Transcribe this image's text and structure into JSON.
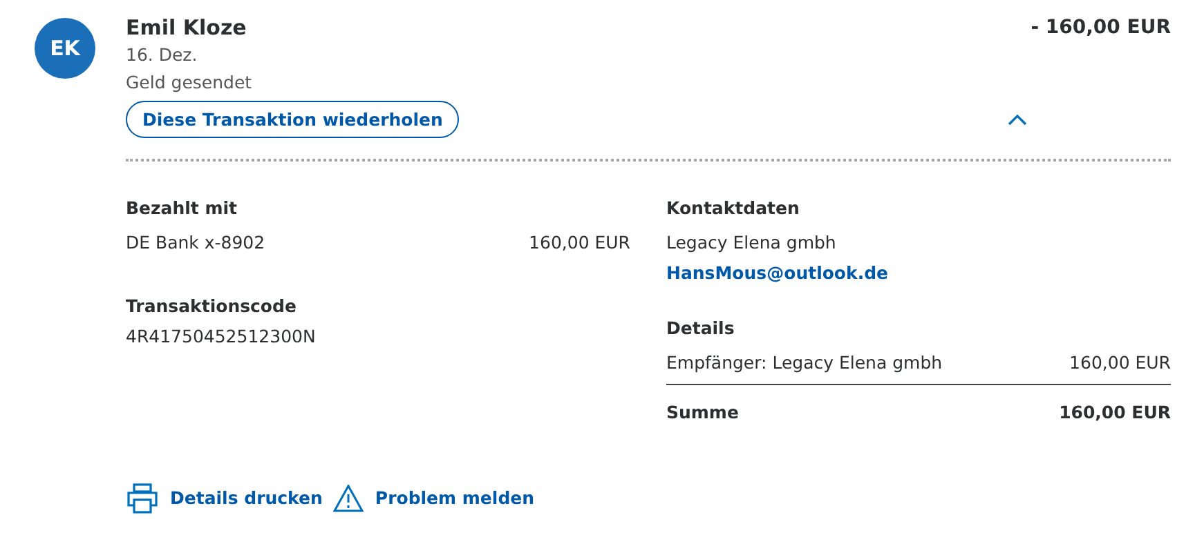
{
  "header": {
    "avatar": "EK",
    "name": "Emil Kloze",
    "date": "16. Dez.",
    "status": "Geld gesendet",
    "amount": "- 160,00 EUR",
    "repeat_button": "Diese Transaktion wiederholen",
    "expanded": true
  },
  "payment": {
    "title": "Bezahlt mit",
    "method": "DE Bank x-8902",
    "amount": "160,00 EUR"
  },
  "transaction": {
    "title": "Transaktionscode",
    "code": "4R41750452512300N"
  },
  "contact": {
    "title": "Kontaktdaten",
    "name": "Legacy Elena gmbh",
    "email": "HansMous@outlook.de"
  },
  "details": {
    "title": "Details",
    "rows": [
      {
        "label": "Empfänger: Legacy Elena gmbh",
        "value": "160,00 EUR"
      }
    ],
    "total_label": "Summe",
    "total_value": "160,00 EUR"
  },
  "actions": [
    {
      "kind": "print",
      "label": "Details drucken"
    },
    {
      "kind": "warning",
      "label": "Problem melden"
    }
  ]
}
